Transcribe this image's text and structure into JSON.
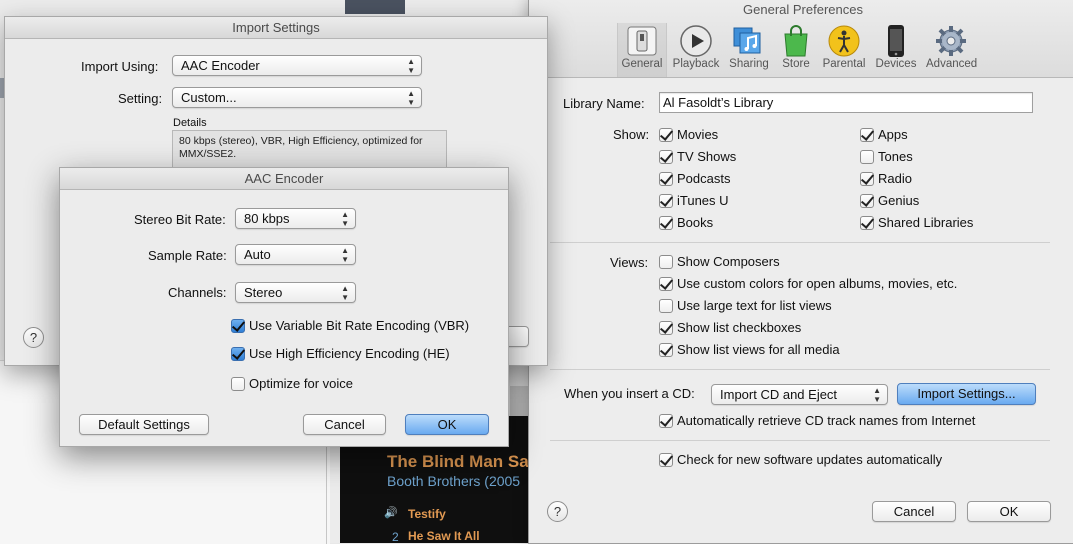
{
  "general_prefs": {
    "title": "General Preferences",
    "toolbar": [
      {
        "label": "General",
        "icon": "general-switch-icon"
      },
      {
        "label": "Playback",
        "icon": "play-icon"
      },
      {
        "label": "Sharing",
        "icon": "sharing-music-icon"
      },
      {
        "label": "Store",
        "icon": "shopping-bag-icon"
      },
      {
        "label": "Parental",
        "icon": "parental-figure-icon"
      },
      {
        "label": "Devices",
        "icon": "phone-icon"
      },
      {
        "label": "Advanced",
        "icon": "gear-icon"
      }
    ],
    "library_name_label": "Library Name:",
    "library_name_value": "Al Fasoldt’s Library",
    "show_label": "Show:",
    "show_items": [
      {
        "label": "Movies",
        "checked": true
      },
      {
        "label": "TV Shows",
        "checked": true
      },
      {
        "label": "Podcasts",
        "checked": true
      },
      {
        "label": "iTunes U",
        "checked": true
      },
      {
        "label": "Books",
        "checked": true
      },
      {
        "label": "Apps",
        "checked": true
      },
      {
        "label": "Tones",
        "checked": false
      },
      {
        "label": "Radio",
        "checked": true
      },
      {
        "label": "Genius",
        "checked": true
      },
      {
        "label": "Shared Libraries",
        "checked": true
      }
    ],
    "views_label": "Views:",
    "view_items": [
      {
        "label": "Show Composers",
        "checked": false
      },
      {
        "label": "Use custom colors for open albums, movies, etc.",
        "checked": true
      },
      {
        "label": "Use large text for list views",
        "checked": false
      },
      {
        "label": "Show list checkboxes",
        "checked": true
      },
      {
        "label": "Show list views for all media",
        "checked": true
      }
    ],
    "cd_label": "When you insert a CD:",
    "cd_value": "Import CD and Eject",
    "import_settings_button": "Import Settings...",
    "auto_retrieve": {
      "label": "Automatically retrieve CD track names from Internet",
      "checked": true
    },
    "check_updates": {
      "label": "Check for new software updates automatically",
      "checked": true
    },
    "cancel": "Cancel",
    "ok": "OK"
  },
  "import_settings": {
    "title": "Import Settings",
    "import_using_label": "Import Using:",
    "import_using_value": "AAC Encoder",
    "setting_label": "Setting:",
    "setting_value": "Custom...",
    "details_label": "Details",
    "details_text": "80 kbps (stereo), VBR, High Efficiency, optimized for MMX/SSE2."
  },
  "aac_encoder": {
    "title": "AAC Encoder",
    "stereo_bit_rate_label": "Stereo Bit Rate:",
    "stereo_bit_rate_value": "80 kbps",
    "sample_rate_label": "Sample Rate:",
    "sample_rate_value": "Auto",
    "channels_label": "Channels:",
    "channels_value": "Stereo",
    "vbr": {
      "label": "Use Variable Bit Rate Encoding (VBR)",
      "checked": true
    },
    "he": {
      "label": "Use High Efficiency Encoding (HE)",
      "checked": true
    },
    "voice": {
      "label": "Optimize for voice",
      "checked": false
    },
    "default_settings": "Default Settings",
    "cancel": "Cancel",
    "ok": "OK"
  },
  "background_player": {
    "album_title": "The Blind Man Sa",
    "artist": "Booth Brothers (2005",
    "tracks": [
      {
        "number": "",
        "title": "Testify"
      },
      {
        "number": "2",
        "title": "He Saw It All"
      }
    ]
  },
  "help_glyph": "?",
  "popup_arrows": "▲▼"
}
